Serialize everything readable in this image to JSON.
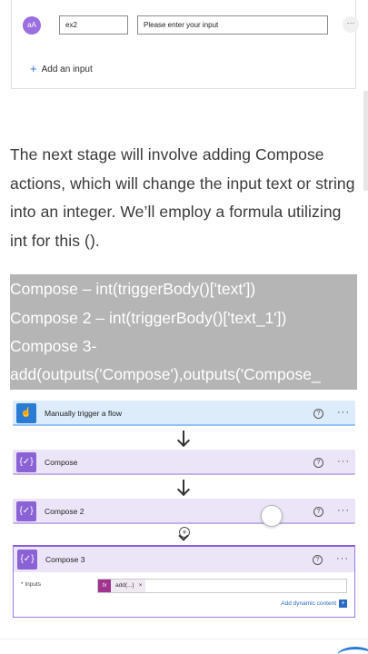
{
  "input_card": {
    "avatar_text": "aA",
    "name_value": "ex2",
    "value_placeholder": "Please enter your input",
    "more_label": "···",
    "add_input_label": "Add an input"
  },
  "article": {
    "paragraph": "The next stage will involve adding  Compose actions, which will change the input text or string into an integer. We’ll employ a formula utilizing int for this ()."
  },
  "code": {
    "line1": "Compose     –  int(triggerBody()['text'])",
    "line2": "Compose 2 –  int(triggerBody()['text_1'])",
    "line3": "Compose 3-",
    "line4": " add(outputs('Compose'),outputs('Compose_"
  },
  "flow": {
    "trigger_label": "Manually trigger a flow",
    "compose1_label": "Compose",
    "compose2_label": "Compose 2",
    "compose3_label": "Compose 3",
    "inputs_label": "* Inputs",
    "token_text": "add(...)",
    "token_fx": "fx",
    "add_dynamic_label": "Add dynamic content",
    "help_glyph": "?",
    "more_glyph": "···",
    "plus_glyph": "+",
    "colors": {
      "trigger": "#2a7bd6",
      "compose": "#8a62d6",
      "token": "#a0338d"
    }
  }
}
